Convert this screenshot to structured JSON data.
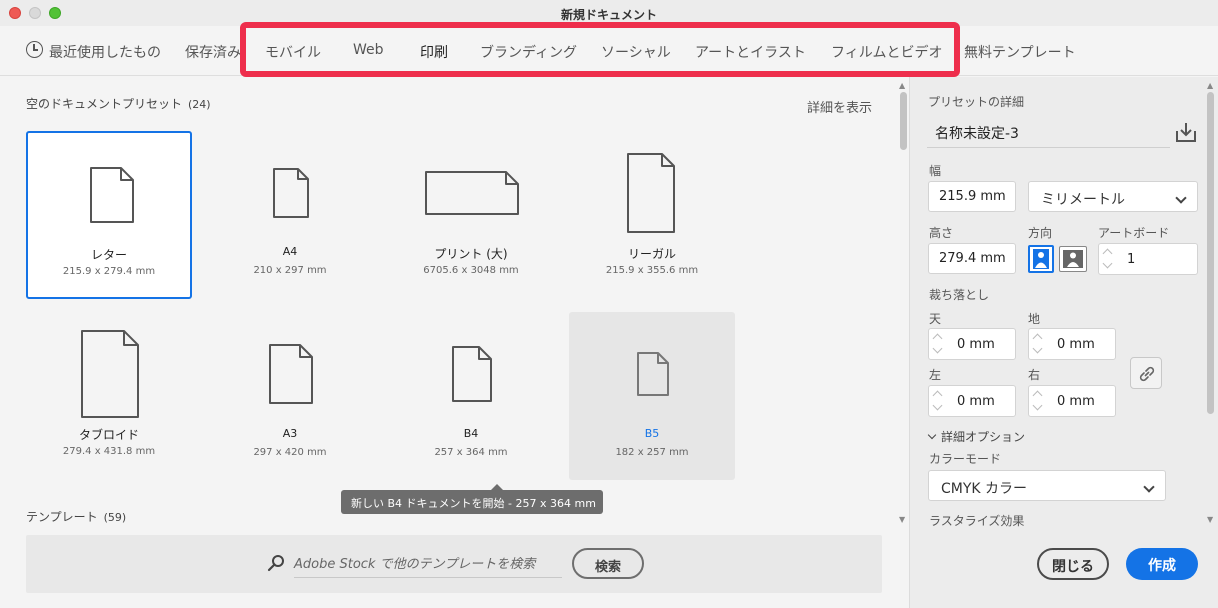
{
  "window": {
    "title": "新規ドキュメント"
  },
  "tabs": [
    {
      "label": "最近使用したもの"
    },
    {
      "label": "保存済み"
    },
    {
      "label": "モバイル"
    },
    {
      "label": "Web"
    },
    {
      "label": "印刷"
    },
    {
      "label": "ブランディング"
    },
    {
      "label": "ソーシャル"
    },
    {
      "label": "アートとイラスト"
    },
    {
      "label": "フィルムとビデオ"
    },
    {
      "label": "無料テンプレート"
    }
  ],
  "presets": {
    "heading": "空のドキュメントプリセット",
    "count": "(24)",
    "show_details": "詳細を表示",
    "items": [
      {
        "name": "レター",
        "dims": "215.9 x 279.4 mm"
      },
      {
        "name": "A4",
        "dims": "210 x 297 mm"
      },
      {
        "name": "プリント (大)",
        "dims": "6705.6 x 3048 mm"
      },
      {
        "name": "リーガル",
        "dims": "215.9 x 355.6 mm"
      },
      {
        "name": "タブロイド",
        "dims": "279.4 x 431.8 mm"
      },
      {
        "name": "A3",
        "dims": "297 x 420 mm"
      },
      {
        "name": "B4",
        "dims": "257 x 364 mm"
      },
      {
        "name": "B5",
        "dims": "182 x 257 mm"
      }
    ],
    "tooltip": "新しい B4 ドキュメントを開始 - 257 x 364 mm"
  },
  "templates": {
    "heading": "テンプレート",
    "count": "(59)",
    "search_placeholder": "Adobe Stock で他のテンプレートを検索",
    "search_button": "検索"
  },
  "panel": {
    "heading": "プリセットの詳細",
    "doc_name": "名称未設定-3",
    "width_label": "幅",
    "width_value": "215.9 mm",
    "unit": "ミリメートル",
    "height_label": "高さ",
    "height_value": "279.4 mm",
    "orientation_label": "方向",
    "artboard_label": "アートボード",
    "artboard_value": "1",
    "bleed_label": "裁ち落とし",
    "bleed_top_label": "天",
    "bleed_top": "0 mm",
    "bleed_bottom_label": "地",
    "bleed_bottom": "0 mm",
    "bleed_left_label": "左",
    "bleed_left": "0 mm",
    "bleed_right_label": "右",
    "bleed_right": "0 mm",
    "advanced_label": "詳細オプション",
    "color_mode_label": "カラーモード",
    "color_mode": "CMYK カラー",
    "raster_label": "ラスタライズ効果",
    "close_button": "閉じる",
    "create_button": "作成"
  },
  "colors": {
    "accent": "#1473e6",
    "highlight": "#ee2e4c"
  }
}
